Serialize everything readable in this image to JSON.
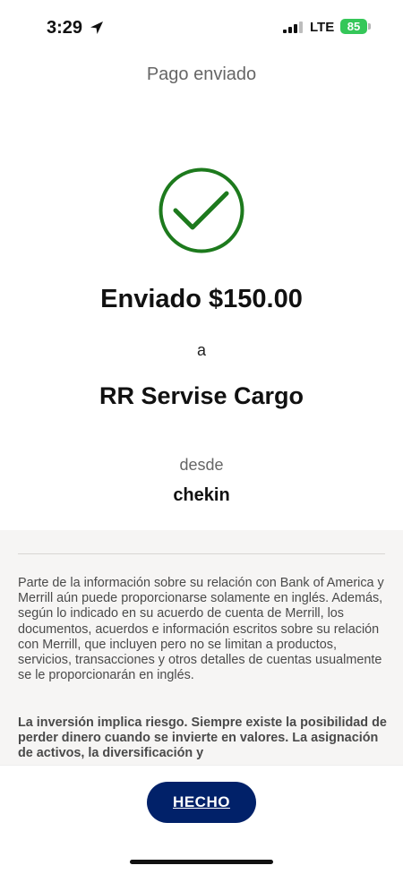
{
  "status_bar": {
    "time": "3:29",
    "location_icon": "location-arrow-icon",
    "signal_icon": "cellular-signal-icon",
    "network": "LTE",
    "battery_level": "85",
    "battery_color": "#35c759"
  },
  "header": {
    "title": "Pago enviado"
  },
  "confirmation": {
    "icon": "checkmark-circle-icon",
    "icon_color": "#1d7a1d",
    "amount_line": "Enviado $150.00",
    "to_label": "a",
    "recipient": "RR Servise Cargo",
    "from_label": "desde",
    "from_account": "chekin"
  },
  "disclosure": {
    "paragraph1": "Parte de la información sobre su relación con Bank of America y Merrill aún puede proporcionarse solamente en inglés. Además, según lo indicado en su acuerdo de cuenta de Merrill, los documentos, acuerdos e información escritos sobre su relación con Merrill, que incluyen pero no se limitan a productos, servicios, transacciones y otros detalles de cuentas usualmente se le proporcionarán en inglés.",
    "paragraph2": "La inversión implica riesgo. Siempre existe la posibilidad de perder dinero cuando se invierte en valores. La asignación de activos, la diversificación y"
  },
  "footer": {
    "done_label": "HECHO",
    "button_color": "#012169"
  }
}
